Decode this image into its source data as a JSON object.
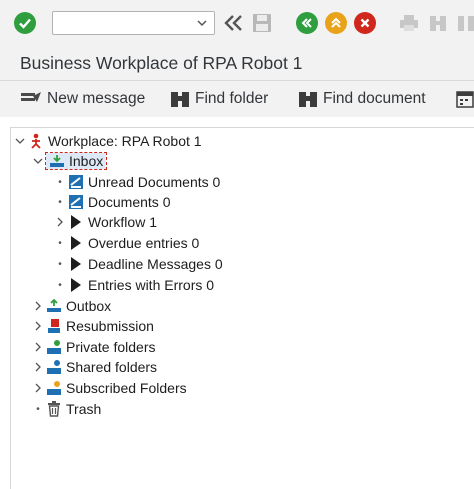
{
  "toolbar": {
    "command_value": "",
    "icons": [
      "enter-icon",
      "back-icon",
      "save-icon",
      "back-nav-icon",
      "exit-icon",
      "cancel-icon",
      "print-icon",
      "find-icon",
      "find-next-icon"
    ]
  },
  "window": {
    "title": "Business Workplace of RPA Robot 1"
  },
  "app_toolbar": {
    "new_message": "New message",
    "find_folder": "Find folder",
    "find_document": "Find document"
  },
  "tree": {
    "root": "Workplace: RPA Robot 1",
    "inbox": {
      "label": "Inbox",
      "children": [
        "Unread Documents 0",
        "Documents 0",
        "Workflow 1",
        "Overdue entries 0",
        "Deadline Messages 0",
        "Entries with Errors 0"
      ]
    },
    "folders": [
      "Outbox",
      "Resubmission",
      "Private folders",
      "Shared folders",
      "Subscribed Folders",
      "Trash"
    ]
  },
  "colors": {
    "accent_green": "#2e9e3e",
    "accent_orange": "#e8a31a",
    "accent_red": "#d0271d",
    "toolbar_bg": "#f2f2f2"
  }
}
